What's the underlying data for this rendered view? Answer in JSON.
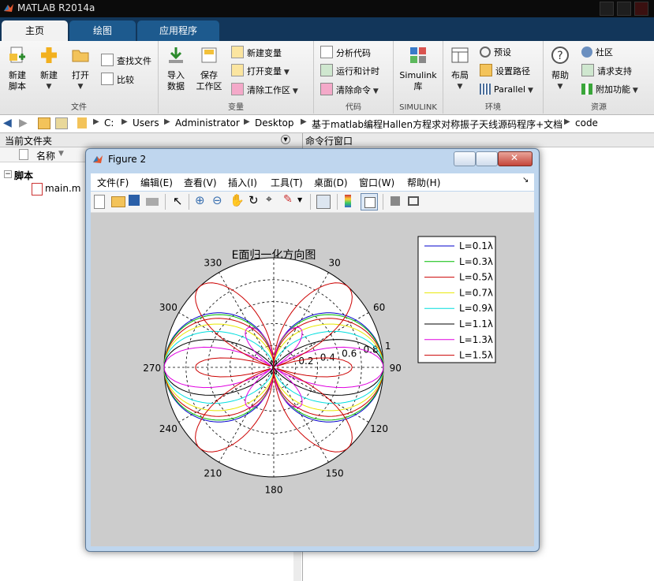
{
  "app": {
    "title": "MATLAB R2014a"
  },
  "ribbon": {
    "tabs": [
      "主页",
      "绘图",
      "应用程序"
    ],
    "groups": {
      "file": {
        "label": "文件",
        "new_script": [
          "新建",
          "脚本"
        ],
        "new": "新建",
        "open": "打开",
        "find_files": "查找文件",
        "compare": "比较"
      },
      "variable": {
        "label": "变量",
        "import": [
          "导入",
          "数据"
        ],
        "save": [
          "保存",
          "工作区"
        ],
        "new_var": "新建变量",
        "open_var": "打开变量",
        "clear_ws": "清除工作区"
      },
      "code": {
        "label": "代码",
        "analyze": "分析代码",
        "run_time": "运行和计时",
        "clear_cmd": "清除命令"
      },
      "simulink": {
        "label": "SIMULINK",
        "lib": [
          "Simulink",
          "库"
        ]
      },
      "env": {
        "label": "环境",
        "layout": "布局",
        "prefs": "预设",
        "set_path": "设置路径",
        "parallel": "Parallel"
      },
      "resources": {
        "label": "资源",
        "help": "帮助",
        "community": "社区",
        "support": "请求支持",
        "addons": "附加功能"
      }
    }
  },
  "address": {
    "parts": [
      "C:",
      "Users",
      "Administrator",
      "Desktop",
      "基于matlab编程Hallen方程求对称振子天线源码程序+文档",
      "code"
    ]
  },
  "left_panel": {
    "title": "当前文件夹",
    "column": "名称",
    "folder": "脚本",
    "file": "main.m"
  },
  "right_panel": {
    "title": "命令行窗口"
  },
  "figure": {
    "title": "Figure 2",
    "menu": [
      "文件(F)",
      "编辑(E)",
      "查看(V)",
      "插入(I)",
      "工具(T)",
      "桌面(D)",
      "窗口(W)",
      "帮助(H)"
    ]
  },
  "chart_data": {
    "type": "polar-line",
    "title": "E面归一化方向图",
    "angle_ticks": [
      "0",
      "30",
      "60",
      "90",
      "120",
      "150",
      "180",
      "210",
      "240",
      "270",
      "300",
      "330"
    ],
    "radial_ticks": [
      "0.2",
      "0.4",
      "0.6",
      "0.8",
      "1"
    ],
    "rlim": [
      0,
      1
    ],
    "theta_zero": "top",
    "theta_direction": "clockwise",
    "grid": true,
    "legend_position": "top-right",
    "series": [
      {
        "name": "L=0.1λ",
        "L": 0.1,
        "color": "#0000cc"
      },
      {
        "name": "L=0.3λ",
        "L": 0.3,
        "color": "#00bb00"
      },
      {
        "name": "L=0.5λ",
        "L": 0.5,
        "color": "#cc0000"
      },
      {
        "name": "L=0.7λ",
        "L": 0.7,
        "color": "#e8e800"
      },
      {
        "name": "L=0.9λ",
        "L": 0.9,
        "color": "#00dede"
      },
      {
        "name": "L=1.1λ",
        "L": 1.1,
        "color": "#000000"
      },
      {
        "name": "L=1.3λ",
        "L": 1.3,
        "color": "#e000e0"
      },
      {
        "name": "L=1.5λ",
        "L": 1.5,
        "color": "#cc0000"
      }
    ]
  }
}
